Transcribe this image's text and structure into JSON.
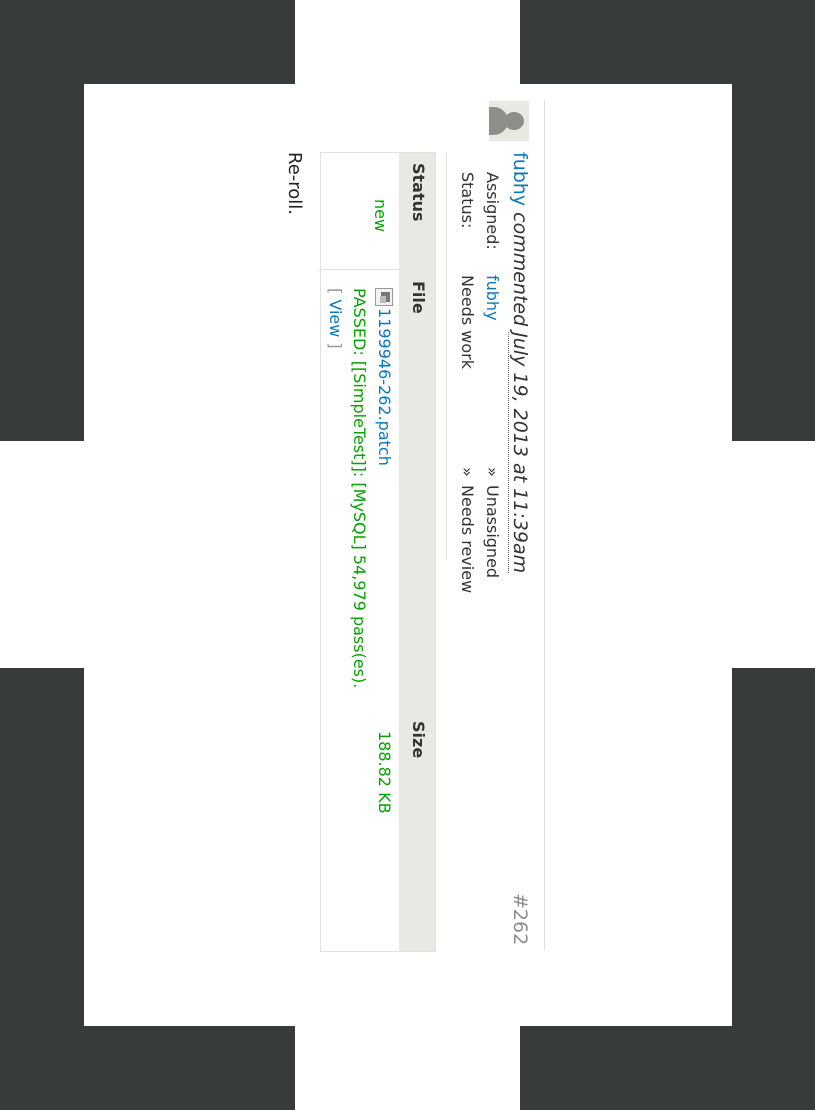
{
  "comment": {
    "author": "fubhy",
    "verb": "commented",
    "date": "July 19, 2013 at 11:39am",
    "number": "#262",
    "avatar_icon": "user-avatar-icon",
    "changes": [
      {
        "label": "Assigned:",
        "from": "fubhy",
        "arrow": "»",
        "to": "Unassigned"
      },
      {
        "label": "Status:",
        "from": "Needs work",
        "arrow": "»",
        "to": "Needs review"
      }
    ],
    "files_table": {
      "headers": {
        "status": "Status",
        "file": "File",
        "size": "Size"
      },
      "row": {
        "status": "new",
        "file_icon": "file-icon",
        "file_name": "1199946-262.patch",
        "size": "188.82 KB",
        "test_result": "PASSED: [[SimpleTest]]: [MySQL] 54,979 pass(es).",
        "view_open": "[",
        "view_label": "View",
        "view_close": "]"
      }
    },
    "body": "Re-roll."
  },
  "colors": {
    "link": "#0678be",
    "passed": "#05a200",
    "header_bg": "#e9e9e4",
    "frame": "#373b3c"
  }
}
